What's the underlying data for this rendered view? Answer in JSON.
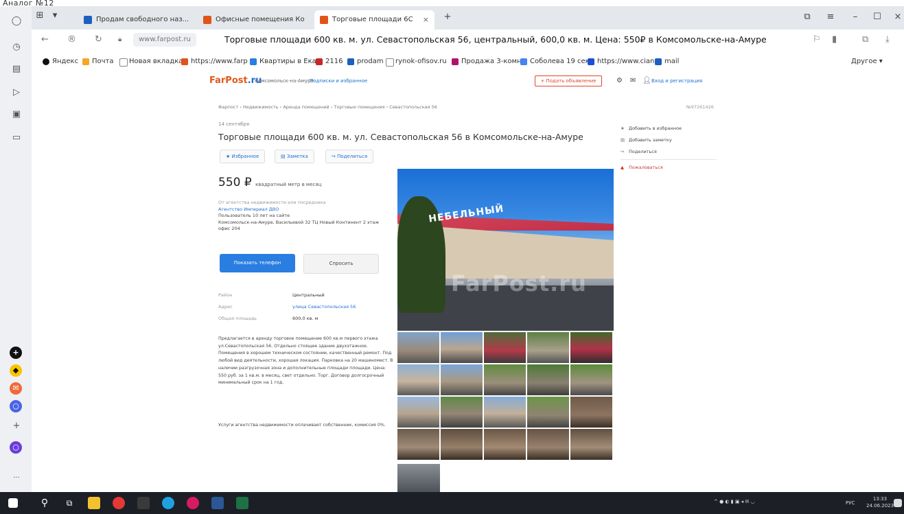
{
  "caption": "Аналог №12",
  "browser": {
    "tabs": [
      {
        "label": "Продам свободного наз...",
        "color": "#1d5fbf"
      },
      {
        "label": "Офисные помещения Ко",
        "color": "#e0541a"
      },
      {
        "label": "Торговые площади 6С",
        "color": "#e0541a",
        "active": true
      }
    ],
    "address": {
      "domain": "www.farpost.ru",
      "title": "Торговые площади 600 кв. м. ул. Севастопольская 56, центральный, 600,0 кв. м. Цена: 550₽ в Комсомольске-на-Амуре"
    },
    "bookmarks": [
      {
        "label": "Яндекс",
        "color": "#111"
      },
      {
        "label": "Почта",
        "color": "#f5a623"
      },
      {
        "label": "Новая вкладка",
        "color": "#ffffff"
      },
      {
        "label": "https://www.farp",
        "color": "#e0541a"
      },
      {
        "label": "Квартиры в Екат",
        "color": "#2a7de1"
      },
      {
        "label": "2116",
        "color": "#c62828"
      },
      {
        "label": "prodam",
        "color": "#1d5fbf"
      },
      {
        "label": "rynok-ofisov.ru",
        "color": "#ffffff"
      },
      {
        "label": "Продажа 3-комн",
        "color": "#b0126b"
      },
      {
        "label": "Соболева 19 сек",
        "color": "#4285f4"
      },
      {
        "label": "https://www.cian.",
        "color": "#1a4fd6"
      },
      {
        "label": "mail",
        "color": "#1d5fbf"
      },
      {
        "label": "Другое",
        "color": "#ffffff"
      }
    ]
  },
  "site": {
    "logo_a": "FarPost",
    "logo_b": ".ru",
    "city": "Комсомольск-на-Амуре",
    "subscribe": "Подписки и избранное",
    "post_button": "+ Подать объявление",
    "login": "Вход и регистрация"
  },
  "listing": {
    "breadcrumb": "Фарпост › Недвижимость › Аренда помещений › Торговые помещения › Севастопольская 56",
    "ad_id": "№97261426",
    "date": "14 сентября",
    "title": "Торговые площади 600 кв. м. ул. Севастопольская 56 в Комсомольске-на-Амуре",
    "actions": [
      "★ Избранное",
      "▤ Заметка",
      "↪ Поделиться"
    ],
    "price": "550 ₽",
    "price_unit": "квадратный метр в месяц",
    "seller_note": "От агентства недвижимости или посредника",
    "seller_name": "Агентство Империал ДВО",
    "seller_years": "Пользователь 10 лет на сайте",
    "seller_address": "Комсомольск-на-Амуре, Васильевой 32 ТЦ Новый Континент 2 этаж офис 204",
    "btn_phone": "Показать телефон",
    "btn_ask": "Спросить",
    "props": [
      {
        "k": "Район",
        "v": "Центральный",
        "link": false
      },
      {
        "k": "Адрес",
        "v": "улица Севастопольская 56",
        "link": true
      },
      {
        "k": "Общая площадь",
        "v": "600,0 кв. м",
        "link": false
      }
    ],
    "description": "Предлагается в аренду торговое помещение 600 кв.м первого этажа ул.Севастопольская 56. Отдельно стоящее здание двухэтажное. Помещения в хорошем техническом состоянии, качественный ремонт. Под любой вид деятельности, хорошая локация. Парковка на 20 машиномест. В наличии разгрузочная зона и дополнительные площади площади. Цена: 550 руб. за 1 кв.м. в месяц, свет отдельно. Торг. Договор долгосрочный минимальный срок на 1 год.",
    "description2": "Услуги агентства недвижимости оплачивает собственник, комиссия 0%.",
    "photo_sign": "НЕБЕЛЬНЫЙ",
    "watermark": "FarPost.ru"
  },
  "side": {
    "items": [
      "Добавить в избранное",
      "Добавить заметку",
      "Поделиться"
    ],
    "complain": "Пожаловаться"
  },
  "taskbar": {
    "lang": "РУС",
    "time": "13:33",
    "date": "24.06.2023"
  }
}
